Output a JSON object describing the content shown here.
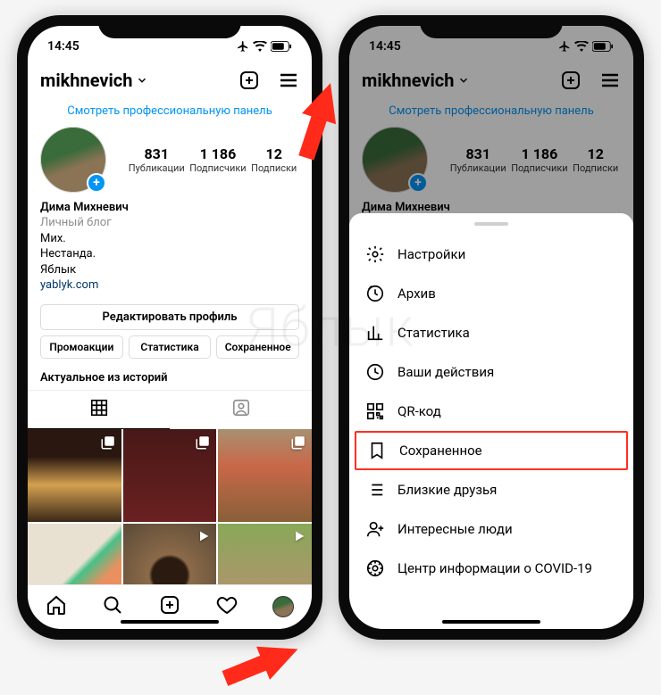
{
  "status": {
    "time": "14:45"
  },
  "header": {
    "username": "mikhnevich"
  },
  "promo_link": "Смотреть профессиональную панель",
  "stats": {
    "posts": {
      "num": "831",
      "label": "Публикации"
    },
    "followers": {
      "num": "1 186",
      "label": "Подписчики"
    },
    "following": {
      "num": "12",
      "label": "Подписки"
    }
  },
  "bio": {
    "name": "Дима Михневич",
    "category": "Личный блог",
    "line1": "Мих.",
    "line2": "Нестанда.",
    "line3": "Яблык",
    "link": "yablyk.com"
  },
  "edit_button": "Редактировать профиль",
  "actions": {
    "promo": "Промоакции",
    "stats": "Статистика",
    "saved": "Сохраненное"
  },
  "highlights_title": "Актуальное из историй",
  "sheet": {
    "settings": "Настройки",
    "archive": "Архив",
    "stats": "Статистика",
    "activity": "Ваши действия",
    "qr": "QR-код",
    "saved": "Сохраненное",
    "close_friends": "Близкие друзья",
    "discover": "Интересные люди",
    "covid": "Центр информации о COVID-19"
  },
  "watermark": "Яблык"
}
